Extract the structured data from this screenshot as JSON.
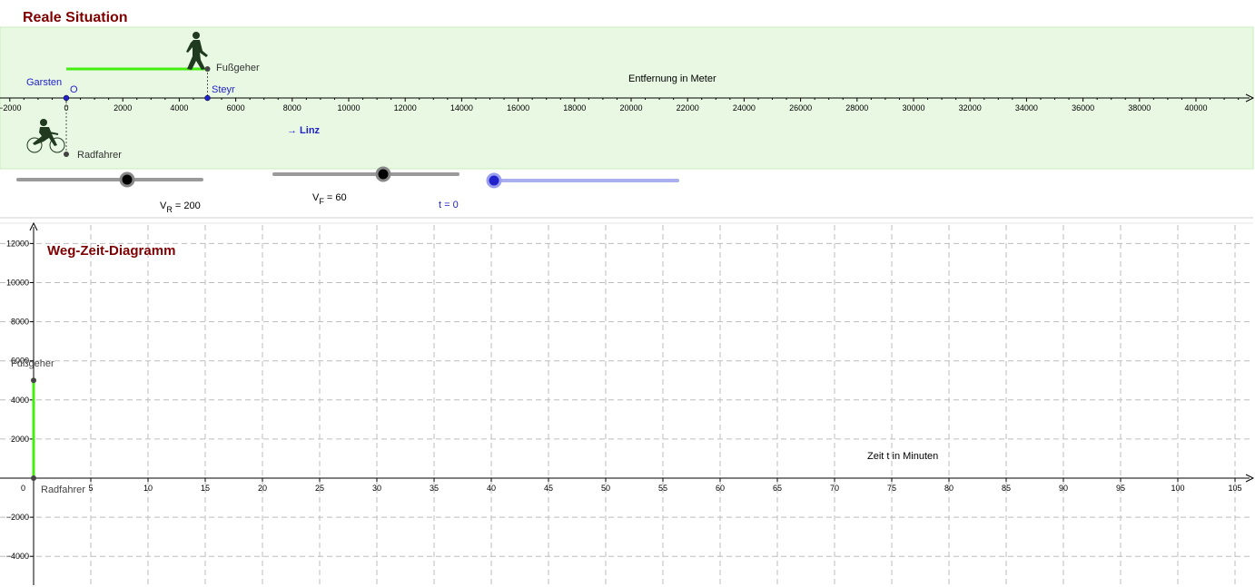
{
  "top": {
    "title": "Reale Situation",
    "axis_label": "Entfernung in Meter",
    "x_ticks": [
      -2000,
      0,
      2000,
      4000,
      6000,
      8000,
      10000,
      12000,
      14000,
      16000,
      18000,
      20000,
      22000,
      24000,
      26000,
      28000,
      30000,
      32000,
      34000,
      36000,
      38000,
      40000
    ],
    "x_tick_labels": [
      "−2000",
      "0",
      "2000",
      "4000",
      "6000",
      "8000",
      "10000",
      "12000",
      "14000",
      "16000",
      "18000",
      "20000",
      "22000",
      "24000",
      "26000",
      "28000",
      "30000",
      "32000",
      "34000",
      "36000",
      "38000",
      "40000"
    ],
    "points": {
      "garsten": "Garsten",
      "origin": "O",
      "steyr": "Steyr",
      "fussgeher": "Fußgeher",
      "radfahrer": "Radfahrer"
    },
    "linz_label": "→ Linz",
    "walker_start_m": 0,
    "walker_position_m": 5000,
    "steyr_position_m": 5000,
    "cyclist_position_m": 0,
    "colors": {
      "panel": "#e8f8e3",
      "green_line": "#44ee11",
      "blue_point": "#2222cc",
      "title": "#7f0000"
    }
  },
  "sliders": {
    "vr": {
      "label_main": "V",
      "label_sub": "R",
      "label_value": " = 200",
      "value": 200
    },
    "vf": {
      "label_main": "V",
      "label_sub": "F",
      "label_value": " = 60",
      "value": 60
    },
    "t": {
      "label": "t = 0",
      "value": 0
    }
  },
  "bottom": {
    "title": "Weg-Zeit-Diagramm",
    "x_axis_label": "Zeit t in Minuten",
    "fussgeher_label": "Fußgeher",
    "radfahrer_label": "Radfahrer",
    "origin_label": "0"
  },
  "chart_data": {
    "type": "line",
    "title": "Weg-Zeit-Diagramm",
    "xlabel": "Zeit t in Minuten",
    "ylabel": "",
    "xlim": [
      0,
      107
    ],
    "ylim": [
      -5000,
      13000
    ],
    "x_ticks": [
      5,
      10,
      15,
      20,
      25,
      30,
      35,
      40,
      45,
      50,
      55,
      60,
      65,
      70,
      75,
      80,
      85,
      90,
      95,
      100,
      105
    ],
    "y_ticks": [
      -4000,
      -2000,
      2000,
      4000,
      6000,
      8000,
      10000,
      12000
    ],
    "y_tick_labels": [
      "−4000",
      "−2000",
      "2000",
      "4000",
      "6000",
      "8000",
      "10000",
      "12000"
    ],
    "grid": true,
    "series": [
      {
        "name": "Fußgeher",
        "x": [
          0
        ],
        "y": [
          5000
        ]
      },
      {
        "name": "Radfahrer",
        "x": [
          0
        ],
        "y": [
          0
        ]
      }
    ],
    "segments": [
      {
        "x": [
          0,
          0
        ],
        "y": [
          0,
          5000
        ]
      }
    ]
  }
}
